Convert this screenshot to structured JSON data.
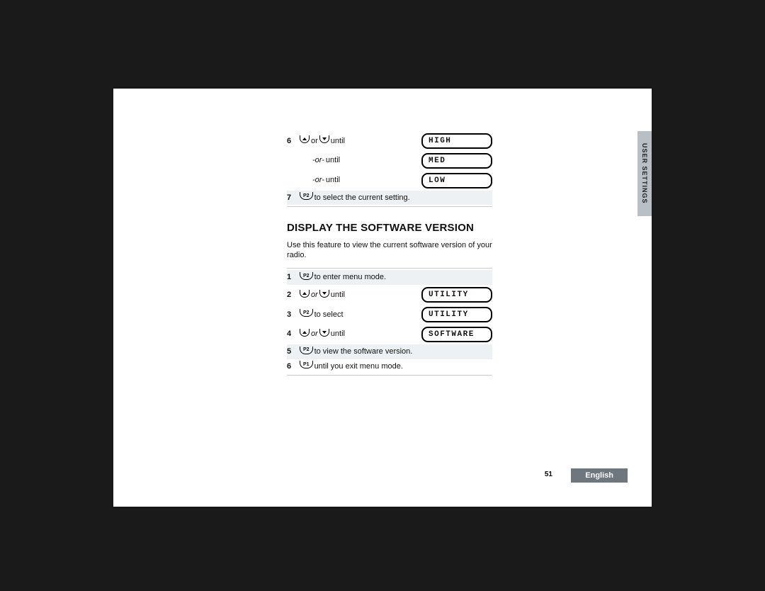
{
  "sideTab": "USER SETTINGS",
  "pageNumber": "51",
  "language": "English",
  "btn": {
    "p1": "P1",
    "p2": "P2"
  },
  "word": {
    "or": "or",
    "until": "until",
    "orItalic": "or",
    "orDash": "-or-"
  },
  "top": {
    "step6": "6",
    "step7": "7",
    "step7text": "to select the current setting.",
    "disp": {
      "high": "HIGH",
      "med": "MED",
      "low": "LOW"
    }
  },
  "section": {
    "title": "DISPLAY THE SOFTWARE VERSION",
    "intro": "Use this feature to view the current software version of your radio."
  },
  "steps": {
    "s1": {
      "n": "1",
      "text": "to enter menu mode."
    },
    "s2": {
      "n": "2",
      "disp": "UTILITY"
    },
    "s3": {
      "n": "3",
      "text": "to select",
      "disp": "UTILITY"
    },
    "s4": {
      "n": "4",
      "disp": "SOFTWARE"
    },
    "s5": {
      "n": "5",
      "text": "to view the software version."
    },
    "s6": {
      "n": "6",
      "text": "until you exit menu mode."
    }
  }
}
